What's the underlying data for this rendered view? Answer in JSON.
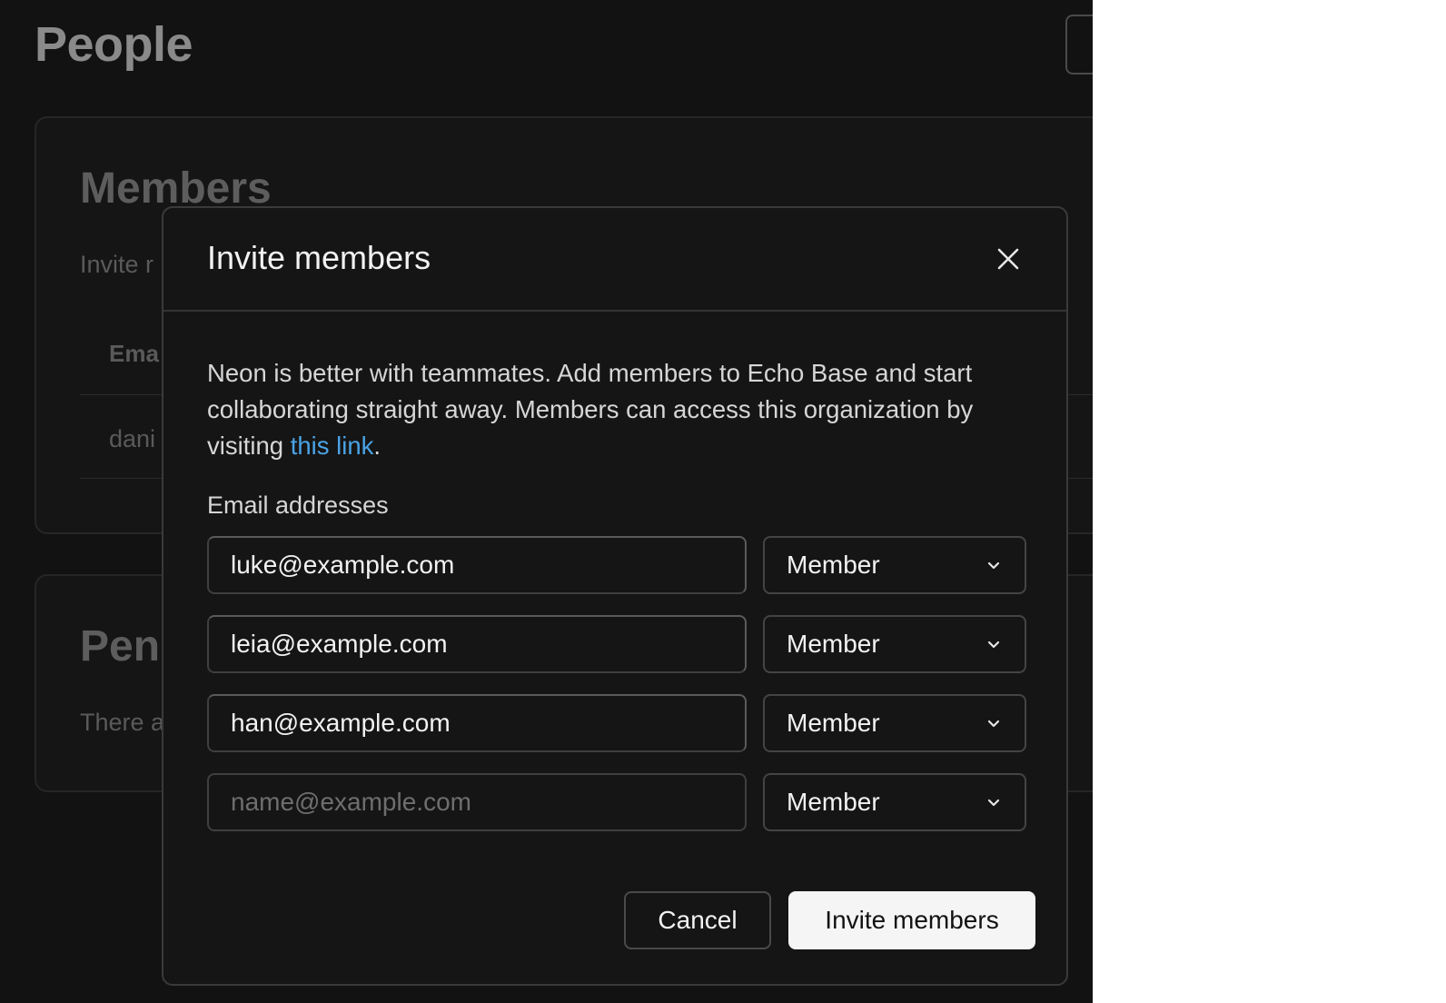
{
  "page": {
    "title": "People"
  },
  "members_card": {
    "title": "Members",
    "description": "Invite r",
    "column_email": "Ema",
    "row_email": "dani"
  },
  "pending_card": {
    "title": "Pend",
    "description": "There a"
  },
  "modal": {
    "title": "Invite members",
    "body_before_link": "Neon is better with teammates. Add members to Echo Base and start collaborating straight away. Members can access this organization by visiting ",
    "link_text": "this link",
    "body_after_link": ".",
    "email_label": "Email addresses",
    "rows": [
      {
        "email": "luke@example.com",
        "role": "Member"
      },
      {
        "email": "leia@example.com",
        "role": "Member"
      },
      {
        "email": "han@example.com",
        "role": "Member"
      },
      {
        "email": "",
        "placeholder": "name@example.com",
        "role": "Member"
      }
    ],
    "cancel_label": "Cancel",
    "invite_label": "Invite members"
  },
  "icons": {
    "close": "close-icon",
    "chevron": "chevron-down-icon"
  },
  "colors": {
    "background": "#121212",
    "modal": "#151515",
    "link": "#4aa3e6",
    "primary_button": "#f5f5f5"
  }
}
